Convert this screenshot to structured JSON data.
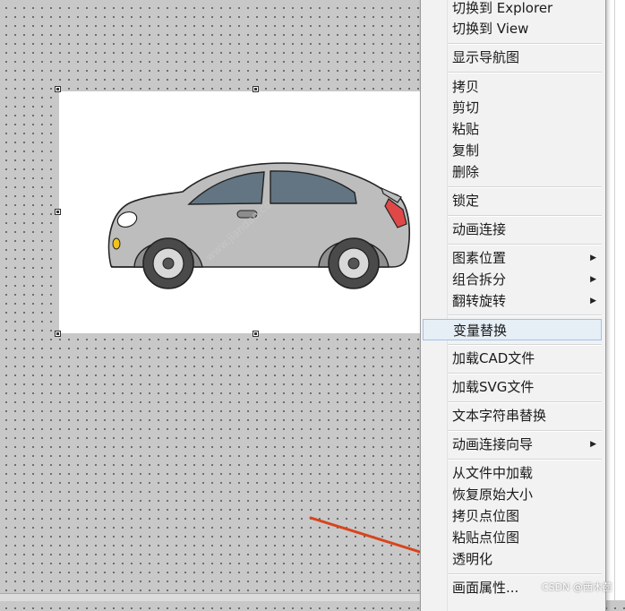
{
  "canvas": {
    "background": "#c8c8c8"
  },
  "image": {
    "subject": "car-illustration",
    "body_color": "#bdbdbd",
    "window_color": "#637582",
    "taillight_color": "#e04848",
    "indicator_color": "#f2c318",
    "watermark_text": "www.jiandao.co"
  },
  "context_menu": {
    "items": [
      {
        "label": "切换到 Explorer",
        "submenu": false
      },
      {
        "label": "切换到 View",
        "submenu": false
      },
      {
        "label": "显示导航图",
        "submenu": false
      },
      {
        "label": "拷贝",
        "submenu": false
      },
      {
        "label": "剪切",
        "submenu": false
      },
      {
        "label": "粘贴",
        "submenu": false
      },
      {
        "label": "复制",
        "submenu": false
      },
      {
        "label": "删除",
        "submenu": false
      },
      {
        "label": "锁定",
        "submenu": false
      },
      {
        "label": "动画连接",
        "submenu": false
      },
      {
        "label": "图素位置",
        "submenu": true
      },
      {
        "label": "组合拆分",
        "submenu": true
      },
      {
        "label": "翻转旋转",
        "submenu": true
      },
      {
        "label": "变量替换",
        "submenu": false,
        "highlighted": true
      },
      {
        "label": "加载CAD文件",
        "submenu": false
      },
      {
        "label": "加载SVG文件",
        "submenu": false
      },
      {
        "label": "文本字符串替换",
        "submenu": false
      },
      {
        "label": "动画连接向导",
        "submenu": true
      },
      {
        "label": "从文件中加载",
        "submenu": false
      },
      {
        "label": "恢复原始大小",
        "submenu": false
      },
      {
        "label": "拷贝点位图",
        "submenu": false
      },
      {
        "label": "粘贴点位图",
        "submenu": false
      },
      {
        "label": "透明化",
        "submenu": false
      },
      {
        "label": "画面属性...",
        "submenu": false
      }
    ],
    "submenu_arrow": "▶",
    "highlight_color": "#e6eef6"
  },
  "annotation": {
    "arrow_color": "#d9441c",
    "points_to": "透明化"
  },
  "footer": {
    "watermark": "CSDN @西木茴"
  }
}
